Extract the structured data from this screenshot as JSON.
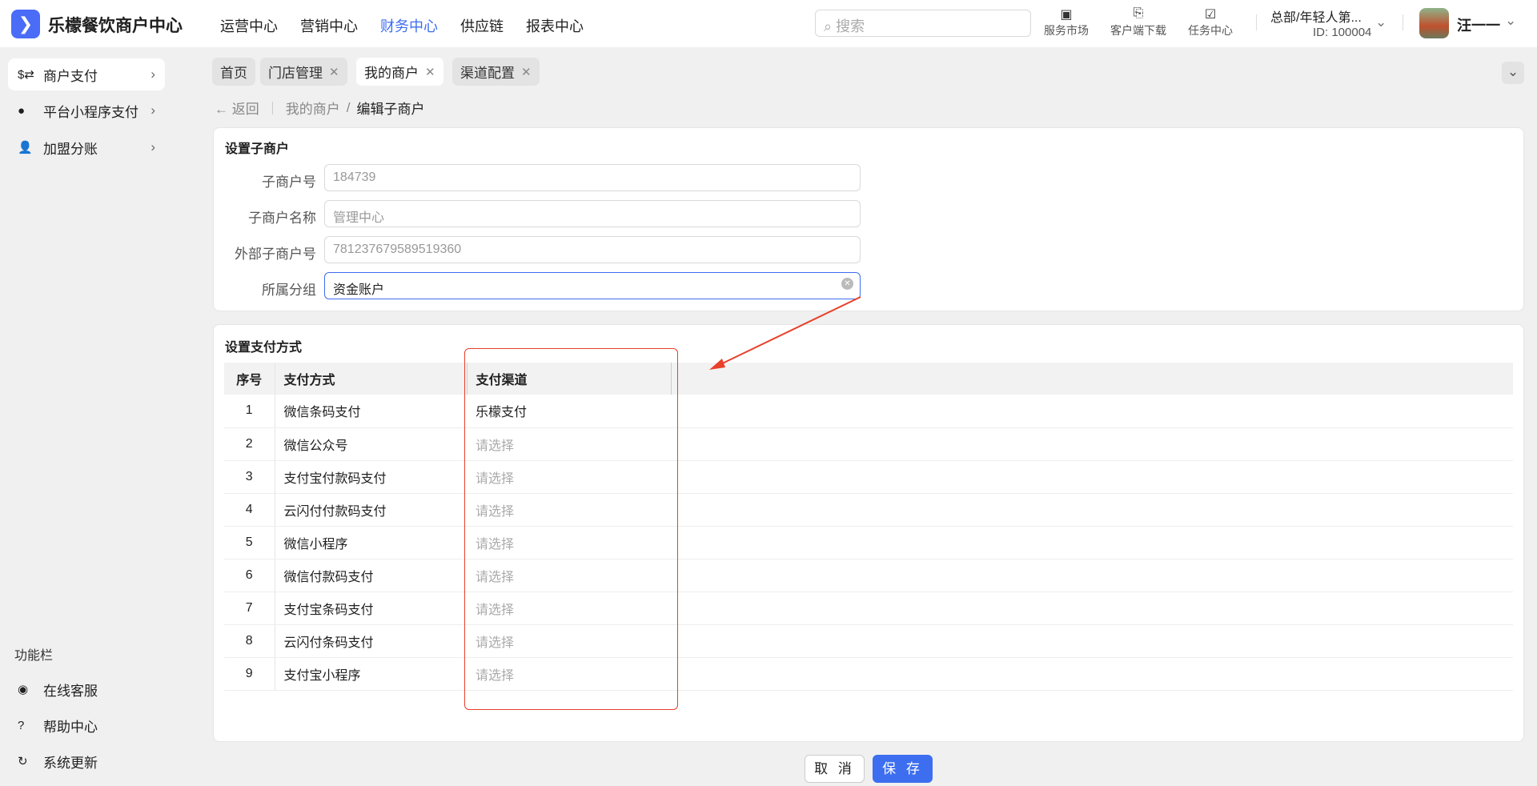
{
  "header": {
    "brand": "乐檬餐饮商户中心",
    "nav": [
      "运营中心",
      "营销中心",
      "财务中心",
      "供应链",
      "报表中心"
    ],
    "active_nav": "财务中心",
    "search_placeholder": "搜索",
    "tools": [
      {
        "label": "服务市场",
        "icon": "shop-bag-icon"
      },
      {
        "label": "客户端下载",
        "icon": "folder-download-icon"
      },
      {
        "label": "任务中心",
        "icon": "clipboard-check-icon"
      }
    ],
    "org": "总部/年轻人第...",
    "org_id": "ID: 100004",
    "user": "汪一一"
  },
  "sidebar": {
    "items": [
      {
        "label": "商户支付",
        "icon": "exchange-icon"
      },
      {
        "label": "平台小程序支付",
        "icon": "mini-program-icon"
      },
      {
        "label": "加盟分账",
        "icon": "user-add-icon"
      }
    ],
    "section": "功能栏",
    "bottom": [
      {
        "label": "在线客服",
        "icon": "headset-icon"
      },
      {
        "label": "帮助中心",
        "icon": "help-icon"
      },
      {
        "label": "系统更新",
        "icon": "refresh-icon"
      }
    ]
  },
  "tabs": [
    {
      "label": "首页",
      "closable": false
    },
    {
      "label": "门店管理",
      "closable": true
    },
    {
      "label": "我的商户",
      "closable": true
    },
    {
      "label": "渠道配置",
      "closable": true
    }
  ],
  "breadcrumb": {
    "back": "返回",
    "parent": "我的商户",
    "current": "编辑子商户"
  },
  "form": {
    "title": "设置子商户",
    "fields": [
      {
        "label": "子商户号",
        "value": "184739"
      },
      {
        "label": "子商户名称",
        "value": "管理中心"
      },
      {
        "label": "外部子商户号",
        "value": "781237679589519360"
      },
      {
        "label": "所属分组",
        "value": "资金账户"
      }
    ]
  },
  "payment": {
    "title": "设置支付方式",
    "columns": [
      "序号",
      "支付方式",
      "支付渠道"
    ],
    "rows": [
      {
        "no": "1",
        "method": "微信条码支付",
        "channel": "乐檬支付"
      },
      {
        "no": "2",
        "method": "微信公众号",
        "channel": "请选择"
      },
      {
        "no": "3",
        "method": "支付宝付款码支付",
        "channel": "请选择"
      },
      {
        "no": "4",
        "method": "云闪付付款码支付",
        "channel": "请选择"
      },
      {
        "no": "5",
        "method": "微信小程序",
        "channel": "请选择"
      },
      {
        "no": "6",
        "method": "微信付款码支付",
        "channel": "请选择"
      },
      {
        "no": "7",
        "method": "支付宝条码支付",
        "channel": "请选择"
      },
      {
        "no": "8",
        "method": "云闪付条码支付",
        "channel": "请选择"
      },
      {
        "no": "9",
        "method": "支付宝小程序",
        "channel": "请选择"
      }
    ]
  },
  "footer": {
    "cancel": "取 消",
    "save": "保 存"
  },
  "colors": {
    "accent": "#3d6ef0",
    "annotation": "#e8402a"
  }
}
